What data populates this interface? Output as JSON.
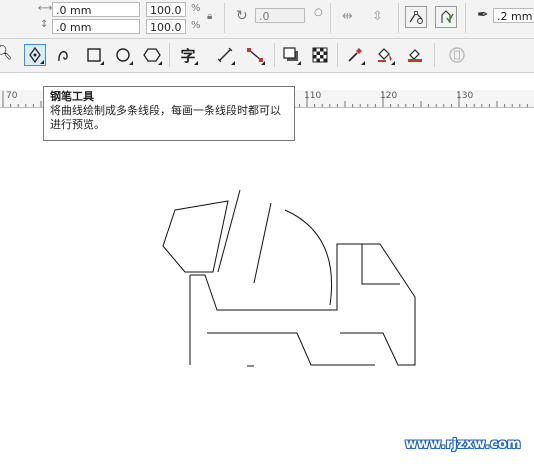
{
  "property_bar": {
    "width_value": ".0 mm",
    "height_value": ".0 mm",
    "scale_x": "100.0",
    "scale_y": "100.0",
    "percent_symbol": "%",
    "rotation_value": ".0",
    "outline_width": ".2 mm"
  },
  "tooltip": {
    "title": "钢笔工具",
    "description": "将曲线绘制成多条线段，每画一条线段时都可以进行预览。"
  },
  "ruler": {
    "labels": [
      "70",
      "110",
      "120",
      "130"
    ]
  },
  "toolbox": {
    "text_tool_glyph": "字"
  },
  "watermark": {
    "text": "www.rjzxw.com",
    "color": "#1f63c4"
  },
  "colors": {
    "active_tool_border": "#3f8fd6",
    "toolbar_bg": "#f3f3f3"
  }
}
